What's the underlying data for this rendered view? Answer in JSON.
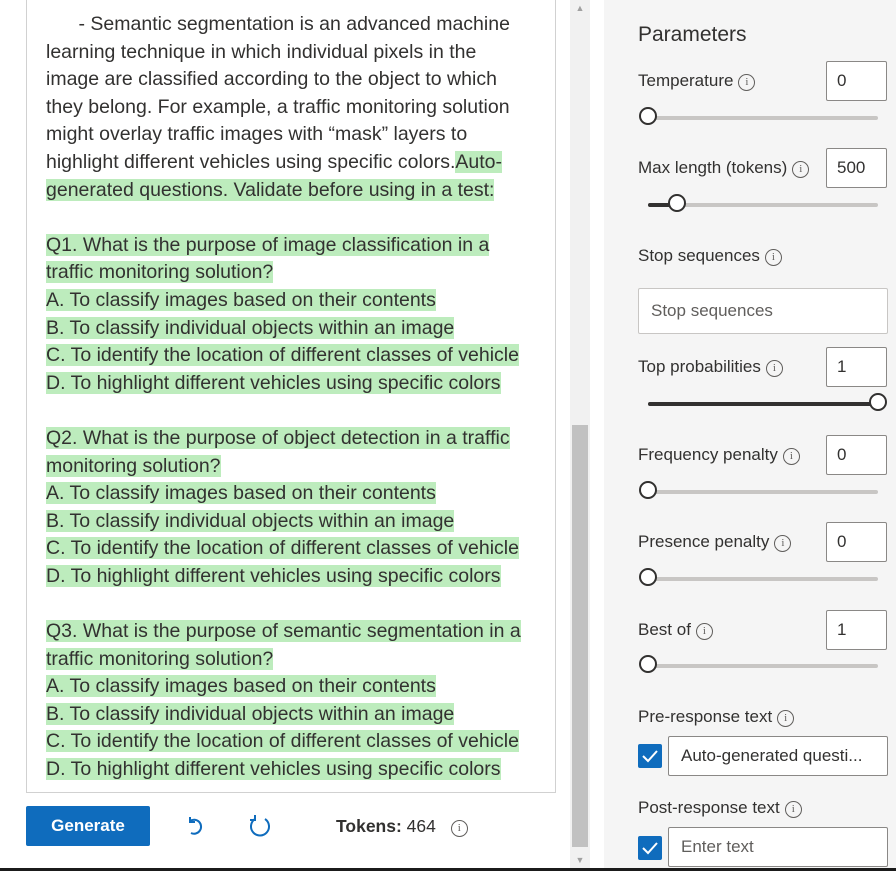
{
  "editor": {
    "lines": [
      {
        "text": "      - Semantic segmentation is an advanced machine",
        "hl": false
      },
      {
        "text": "learning technique in which individual pixels in the",
        "hl": false
      },
      {
        "text": "image are classified according to the object to which",
        "hl": false
      },
      {
        "text": "they belong. For example, a traffic monitoring solution",
        "hl": false
      },
      {
        "text": "might overlay traffic images with “mask” layers to",
        "hl": false
      },
      {
        "plain": "highlight different vehicles using specific colors.",
        "text": "Auto-",
        "hl": true,
        "mixed": true
      },
      {
        "text": "generated questions. Validate before using in a test:",
        "hl": true
      },
      {
        "text": "",
        "hl": false
      },
      {
        "text": "Q1. What is the purpose of image classification in a",
        "hl": true
      },
      {
        "text": "traffic monitoring solution?",
        "hl": true
      },
      {
        "text": "A. To classify images based on their contents",
        "hl": true
      },
      {
        "text": "B. To classify individual objects within an image",
        "hl": true
      },
      {
        "text": "C. To identify the location of different classes of vehicle",
        "hl": true
      },
      {
        "text": "D. To highlight different vehicles using specific colors",
        "hl": true
      },
      {
        "text": "",
        "hl": false
      },
      {
        "text": "Q2. What is the purpose of object detection in a traffic",
        "hl": true
      },
      {
        "text": "monitoring solution?",
        "hl": true
      },
      {
        "text": "A. To classify images based on their contents",
        "hl": true
      },
      {
        "text": "B. To classify individual objects within an image",
        "hl": true
      },
      {
        "text": "C. To identify the location of different classes of vehicle",
        "hl": true
      },
      {
        "text": "D. To highlight different vehicles using specific colors",
        "hl": true
      },
      {
        "text": "",
        "hl": false
      },
      {
        "text": "Q3. What is the purpose of semantic segmentation in a",
        "hl": true
      },
      {
        "text": "traffic monitoring solution?",
        "hl": true
      },
      {
        "text": "A. To classify images based on their contents",
        "hl": true
      },
      {
        "text": "B. To classify individual objects within an image",
        "hl": true
      },
      {
        "text": "C. To identify the location of different classes of vehicle",
        "hl": true
      },
      {
        "text": "D. To highlight different vehicles using specific colors",
        "hl": true
      }
    ]
  },
  "toolbar": {
    "generate_label": "Generate",
    "undo_icon": "undo-icon",
    "regenerate_icon": "refresh-icon",
    "tokens_label": "Tokens:",
    "tokens_value": "464"
  },
  "parameters": {
    "title": "Parameters",
    "temperature": {
      "label": "Temperature",
      "value": "0",
      "slider_fraction": 0.0
    },
    "max_length": {
      "label": "Max length (tokens)",
      "value": "500",
      "slider_fraction": 0.125
    },
    "stop_sequences": {
      "label": "Stop sequences",
      "placeholder": "Stop sequences"
    },
    "top_probabilities": {
      "label": "Top probabilities",
      "value": "1",
      "slider_fraction": 1.0
    },
    "frequency_penalty": {
      "label": "Frequency penalty",
      "value": "0",
      "slider_fraction": 0.0
    },
    "presence_penalty": {
      "label": "Presence penalty",
      "value": "0",
      "slider_fraction": 0.0
    },
    "best_of": {
      "label": "Best of",
      "value": "1",
      "slider_fraction": 0.0
    },
    "pre_response": {
      "label": "Pre-response text",
      "checked": true,
      "value": "Auto-generated questi..."
    },
    "post_response": {
      "label": "Post-response text",
      "checked": true,
      "placeholder": "Enter text"
    }
  },
  "colors": {
    "accent": "#0f6cbd",
    "highlight": "#bdecbd",
    "panel_bg": "#f5f5f5"
  }
}
